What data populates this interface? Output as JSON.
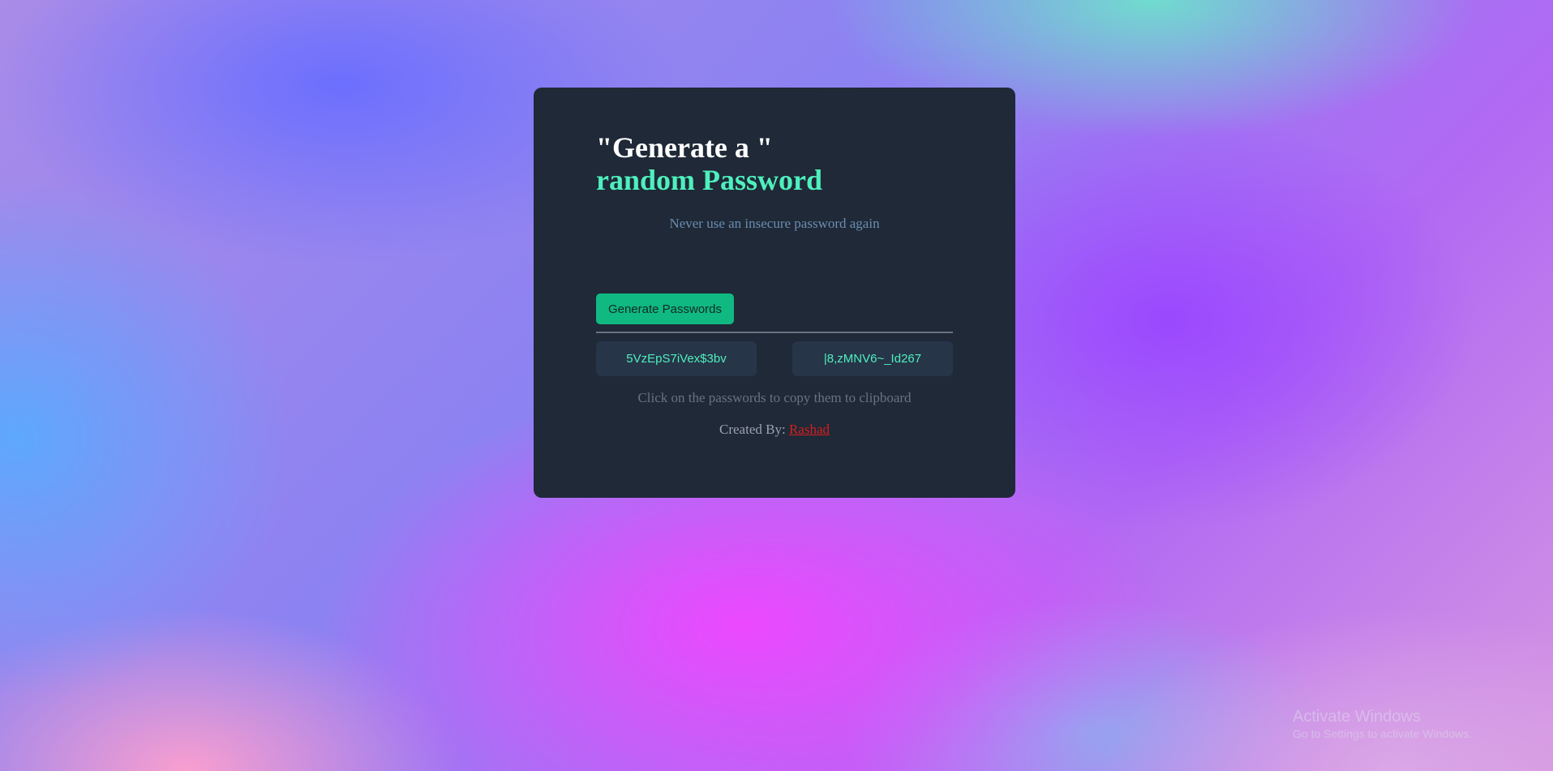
{
  "card": {
    "title_line1": "\"Generate a \"",
    "title_line2": "random Password",
    "subtitle": "Never use an insecure password again",
    "generate_button_label": "Generate Passwords",
    "passwords": [
      "5VzEpS7iVex$3bv",
      "|8,zMNV6~_Id267"
    ],
    "hint": "Click on the passwords to copy them to clipboard",
    "credit_prefix": "Created By:",
    "credit_name": "Rashad"
  },
  "watermark": {
    "title": "Activate Windows",
    "subtitle": "Go to Settings to activate Windows."
  },
  "colors": {
    "card_bg": "#1f2937",
    "accent": "#4ef0bd",
    "button_bg": "#10b981",
    "password_box_bg": "#273549",
    "link": "#d71f1f"
  }
}
